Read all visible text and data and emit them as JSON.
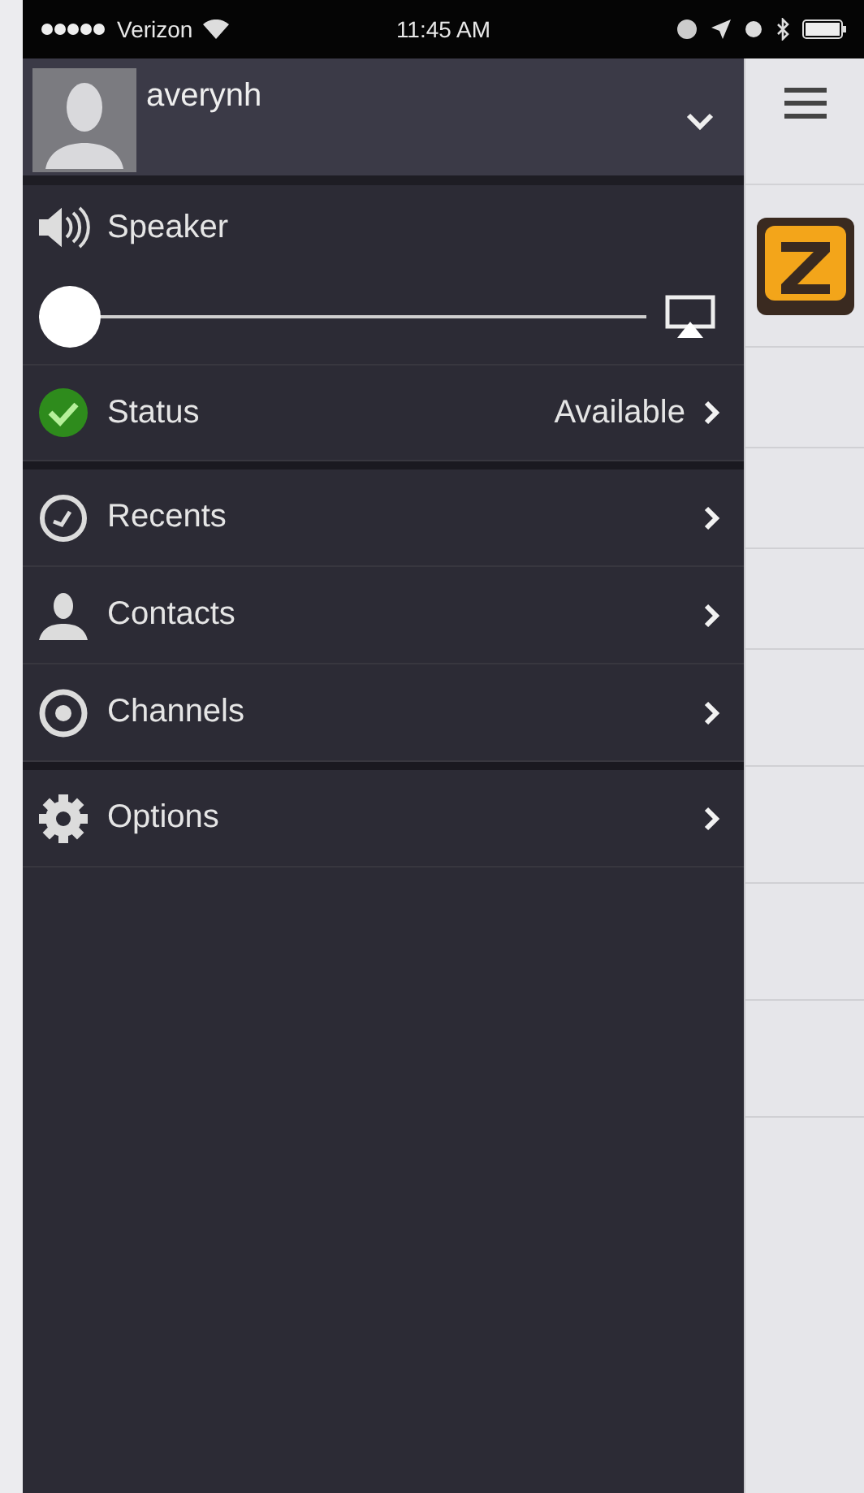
{
  "status_bar": {
    "carrier": "Verizon",
    "time": "11:45 AM"
  },
  "account": {
    "username": "averynh"
  },
  "speaker": {
    "label": "Speaker",
    "level": 0
  },
  "status": {
    "label": "Status",
    "value": "Available"
  },
  "menu_groups": [
    [
      {
        "label": "Recents",
        "kind": "clock"
      },
      {
        "label": "Contacts",
        "kind": "person"
      },
      {
        "label": "Channels",
        "kind": "target"
      }
    ],
    [
      {
        "label": "Options",
        "kind": "gear"
      }
    ]
  ]
}
